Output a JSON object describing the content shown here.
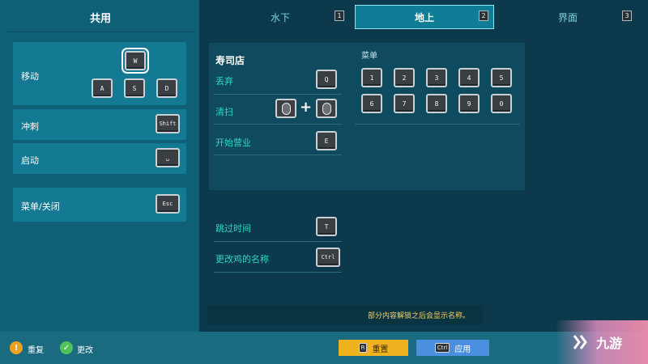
{
  "left_panel": {
    "title": "共用",
    "rows": {
      "move": {
        "label": "移动",
        "keys": [
          "W",
          "A",
          "S",
          "D"
        ]
      },
      "sprint": {
        "label": "冲刺",
        "key": "Shift"
      },
      "launch": {
        "label": "启动",
        "key": "␣"
      },
      "menu_close": {
        "label": "菜单/关闭",
        "key": "Esc"
      }
    }
  },
  "tabs": [
    {
      "label": "水下",
      "num": "1",
      "active": false
    },
    {
      "label": "地上",
      "num": "2",
      "active": true
    },
    {
      "label": "界面",
      "num": "3",
      "active": false
    }
  ],
  "sushi": {
    "title": "寿司店",
    "discard": {
      "label": "丢弃",
      "key": "Q"
    },
    "clean": {
      "label": "清扫",
      "plus": "+"
    },
    "open": {
      "label": "开始营业",
      "key": "E"
    }
  },
  "menu_section": {
    "title": "菜单",
    "keys": [
      "1",
      "2",
      "3",
      "4",
      "5",
      "6",
      "7",
      "8",
      "9",
      "0"
    ]
  },
  "lower": {
    "skip_time": {
      "label": "跳过时间",
      "key": "T"
    },
    "rename_duck": {
      "label": "更改鸡的名称",
      "key": "Ctrl"
    }
  },
  "notice": "部分内容解锁之后会显示名称。",
  "bottom": {
    "undo_label": "重复",
    "change_label": "更改",
    "reset_label": "重置",
    "apply_label": "应用",
    "reset_key": "R",
    "apply_key": "Ctrl"
  },
  "watermark": {
    "text": "九游"
  },
  "colors": {
    "accent_teal": "#2fd8c8",
    "yellow_button": "#f0b21e",
    "blue_button": "#4a8fe0",
    "notice_text": "#f3d36b"
  },
  "icons": {
    "undo": "warning-icon",
    "change": "check-icon",
    "mouse": "mouse-icon"
  }
}
